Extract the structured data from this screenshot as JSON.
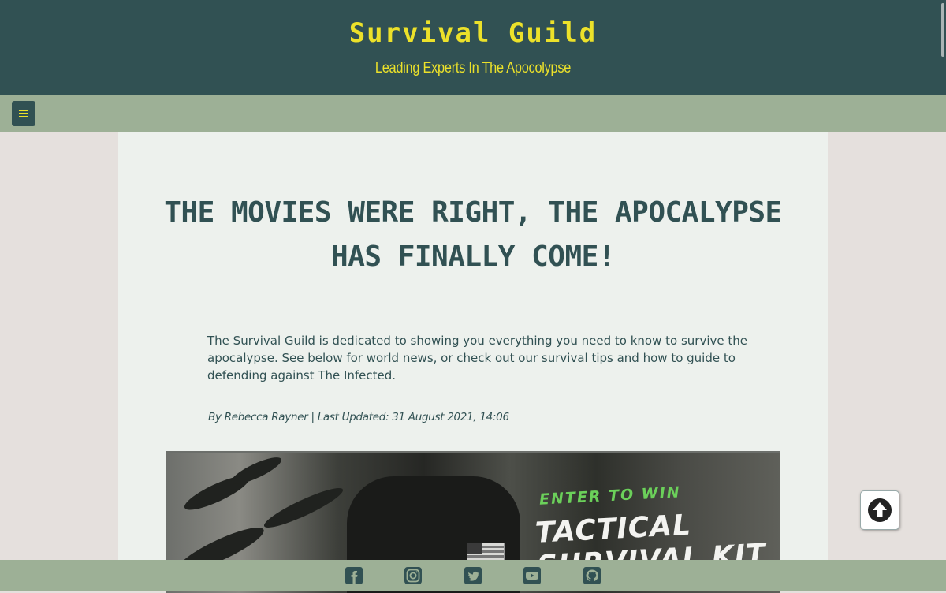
{
  "header": {
    "site_title": "Survival Guild",
    "tagline": "Leading Experts In The Apocolypse"
  },
  "nav": {
    "menu_icon": "hamburger-menu-icon"
  },
  "article": {
    "heading": "THE MOVIES WERE RIGHT, THE APOCALYPSE HAS FINALLY COME!",
    "intro": "The Survival Guild is dedicated to showing you everything you need to know to survive the apocalypse. See below for world news, or check out our survival tips and how to guide to defending against The Infected.",
    "byline": "By Rebecca Rayner | Last Updated: 31 August 2021, 14:06"
  },
  "banner": {
    "kicker": "ENTER TO WIN",
    "title": "TACTICAL SURVIVAL KIT"
  },
  "back_to_top_icon": "arrow-up-circle-icon",
  "footer": {
    "social_icons": [
      "facebook-icon",
      "instagram-icon",
      "twitter-icon",
      "youtube-icon",
      "github-icon"
    ]
  },
  "colors": {
    "header_bg": "#315153",
    "accent_yellow": "#ece12a",
    "nav_green": "#9db096",
    "panel_bg": "#edf1ed",
    "page_bg": "#e5e0dd",
    "text_dark": "#315153"
  }
}
